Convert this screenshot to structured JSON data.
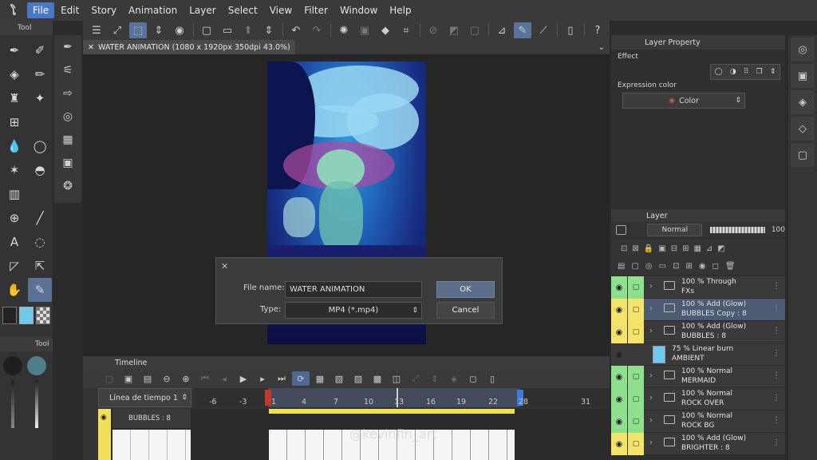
{
  "menu": [
    "File",
    "Edit",
    "Story",
    "Animation",
    "Layer",
    "Select",
    "View",
    "Filter",
    "Window",
    "Help"
  ],
  "menu_active": "File",
  "tool_panel_title": "Tool",
  "sub_tool_panel_title": "Tool",
  "document_tab": "WATER ANIMATION (1080 x 1920px 350dpi 43.0%)",
  "dialog": {
    "file_name_label": "File name:",
    "file_name_value": "WATER ANIMATION",
    "type_label": "Type:",
    "type_value": "MP4 (*.mp4)",
    "ok": "OK",
    "cancel": "Cancel"
  },
  "timeline": {
    "title": "Timeline",
    "name": "Línea de tiempo 1",
    "ruler": [
      "-6",
      "-3",
      "1",
      "4",
      "7",
      "10",
      "13",
      "16",
      "19",
      "22",
      "28",
      "31"
    ],
    "track_label": "BUBBLES : 8",
    "watermark": "@kevinfin_art"
  },
  "layer_property": {
    "title": "Layer Property",
    "effect_label": "Effect",
    "expression_label": "Expression color",
    "expression_value": "Color"
  },
  "layer_panel": {
    "title": "Layer",
    "blend_mode": "Normal",
    "opacity": "100"
  },
  "layers": [
    {
      "line1": "100 %  Through",
      "line2": "FXs",
      "eye": "#8ee08e",
      "lock": "#8ee08e",
      "type": "folder",
      "selected": false
    },
    {
      "line1": "100 %  Add (Glow)",
      "line2": "BUBBLES Copy : 8",
      "eye": "#f4e46a",
      "lock": "#f4e46a",
      "type": "folder",
      "selected": true
    },
    {
      "line1": "100 %  Add (Glow)",
      "line2": "BUBBLES : 8",
      "eye": "#f4e46a",
      "lock": "#f4e46a",
      "type": "folder",
      "selected": false
    },
    {
      "line1": "75 %  Linear burn",
      "line2": "AMBIENT",
      "eye": "#3a3a3a",
      "lock": "#3a3a3a",
      "type": "raster",
      "selected": false
    },
    {
      "line1": "100 %  Normal",
      "line2": "MERMAID",
      "eye": "#8ee08e",
      "lock": "#8ee08e",
      "type": "folder",
      "selected": false
    },
    {
      "line1": "100 %  Normal",
      "line2": "ROCK OVER",
      "eye": "#8ee08e",
      "lock": "#8ee08e",
      "type": "folder",
      "selected": false
    },
    {
      "line1": "100 %  Normal",
      "line2": "ROCK BG",
      "eye": "#8ee08e",
      "lock": "#8ee08e",
      "type": "folder",
      "selected": false
    },
    {
      "line1": "100 %  Add (Glow)",
      "line2": "BRIGHTER : 8",
      "eye": "#f4e46a",
      "lock": "#f4e46a",
      "type": "folder",
      "selected": false
    }
  ],
  "colors": {
    "accent": "#4a78c8",
    "selected_tool": "#5a7394",
    "main_color": "#6fc9ec"
  }
}
